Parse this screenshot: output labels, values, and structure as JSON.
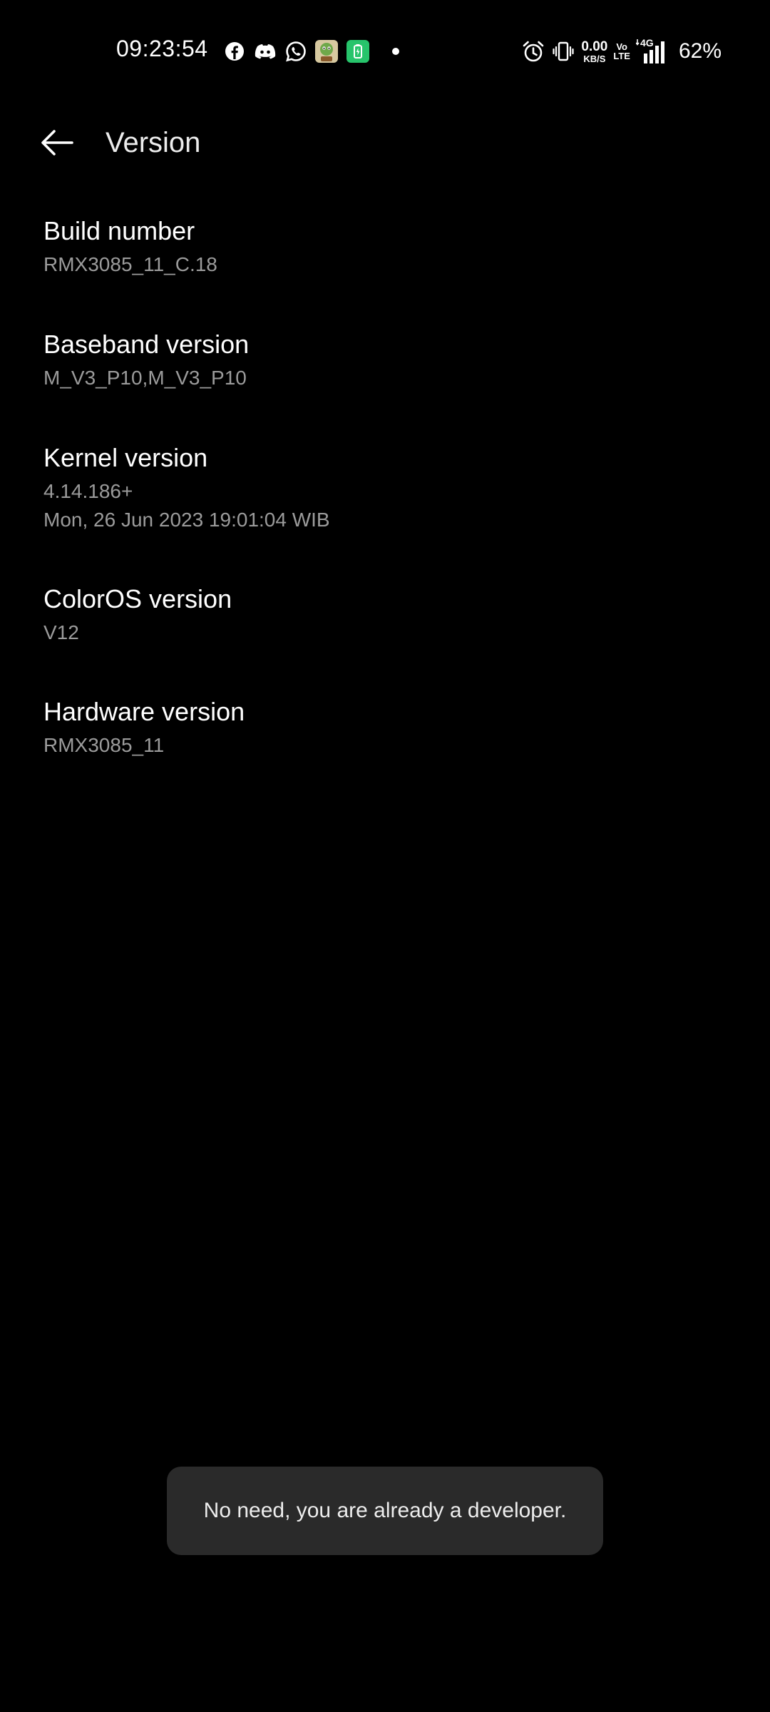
{
  "status_bar": {
    "time": "09:23:54",
    "notification_icons": [
      "facebook-icon",
      "discord-icon",
      "whatsapp-icon",
      "game-app-icon",
      "battery-saver-app-icon",
      "more-dot-icon"
    ],
    "net_speed_value": "0.00",
    "net_speed_unit": "KB/S",
    "volte_top": "Vo",
    "volte_bottom": "LTE",
    "network_type": "4G",
    "battery": "62%"
  },
  "header": {
    "title": "Version"
  },
  "items": [
    {
      "title": "Build number",
      "value": "RMX3085_11_C.18"
    },
    {
      "title": "Baseband version",
      "value": "M_V3_P10,M_V3_P10"
    },
    {
      "title": "Kernel version",
      "value": "4.14.186+\nMon, 26 Jun 2023 19:01:04 WIB"
    },
    {
      "title": "ColorOS version",
      "value": "V12"
    },
    {
      "title": "Hardware version",
      "value": "RMX3085_11"
    }
  ],
  "toast": {
    "message": "No need, you are already a developer."
  },
  "colors": {
    "background": "#000000",
    "primary_text": "#ffffff",
    "secondary_text": "#9b9b9b",
    "toast_background": "#2a2a2a",
    "battery_saver_green": "#27c46b"
  }
}
